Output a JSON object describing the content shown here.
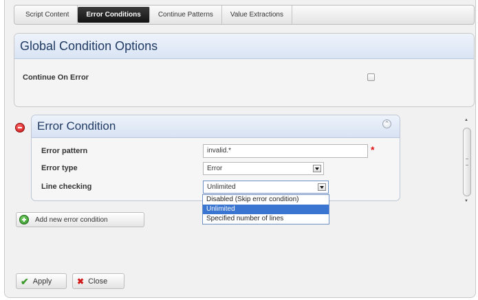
{
  "tabs": [
    {
      "label": "Script Content",
      "active": false
    },
    {
      "label": "Error Conditions",
      "active": true
    },
    {
      "label": "Continue Patterns",
      "active": false
    },
    {
      "label": "Value Extractions",
      "active": false
    }
  ],
  "global": {
    "title": "Global Condition Options",
    "continue_on_error_label": "Continue On Error",
    "continue_on_error_checked": false
  },
  "error_condition": {
    "title": "Error Condition",
    "pattern_label": "Error pattern",
    "pattern_value": "invalid.*",
    "required_mark": "*",
    "type_label": "Error type",
    "type_value": "Error",
    "line_checking_label": "Line checking",
    "line_checking_value": "Unlimited",
    "line_checking_options": [
      "Disabled (Skip error condition)",
      "Unlimited",
      "Specified number of lines"
    ],
    "selected_option_index": 1
  },
  "add_button_label": "Add new error condition",
  "footer": {
    "apply_label": "Apply",
    "close_label": "Close"
  },
  "icons": {
    "remove": "remove-circle-icon",
    "collapse": "collapse-icon",
    "add": "add-circle-icon",
    "apply": "check-icon",
    "close": "x-icon"
  },
  "colors": {
    "header_text": "#203a63",
    "selected_option": "#3a76d1",
    "required": "#dd1111"
  }
}
